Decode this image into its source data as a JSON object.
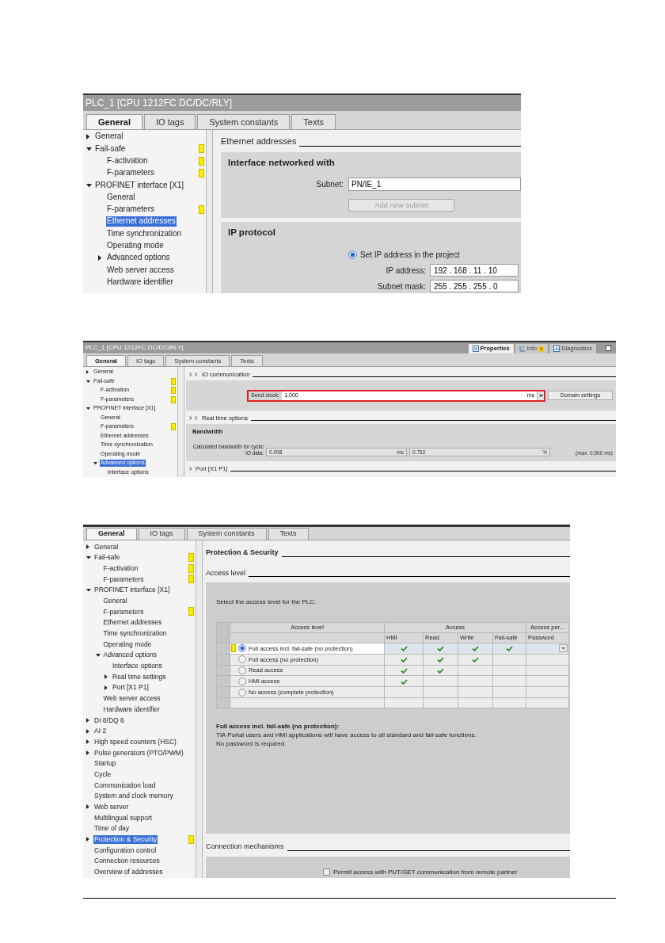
{
  "screenshots": [
    {
      "kind": "addresses",
      "title": "PLC_1 [CPU 1212FC DC/DC/RLY]",
      "tabs": [
        {
          "label": "General",
          "selected": true
        },
        {
          "label": "IO tags",
          "selected": false
        },
        {
          "label": "System constants",
          "selected": false
        },
        {
          "label": "Texts",
          "selected": false
        }
      ],
      "tree": [
        {
          "label": "General",
          "expanded": false,
          "selected": false,
          "flagged": false
        },
        {
          "label": "Fail-safe",
          "expanded": true,
          "selected": false,
          "flagged": true,
          "children": [
            {
              "label": "F-activation",
              "selected": false,
              "flagged": true
            },
            {
              "label": "F-parameters",
              "selected": false,
              "flagged": true
            }
          ]
        },
        {
          "label": "PROFINET interface [X1]",
          "expanded": true,
          "selected": false,
          "flagged": false,
          "children": [
            {
              "label": "General",
              "selected": false,
              "flagged": false
            },
            {
              "label": "F-parameters",
              "selected": false,
              "flagged": true
            },
            {
              "label": "Ethernet addresses",
              "selected": true,
              "flagged": false
            },
            {
              "label": "Time synchronization",
              "selected": false,
              "flagged": false
            },
            {
              "label": "Operating mode",
              "selected": false,
              "flagged": false
            },
            {
              "label": "Advanced options",
              "expanded": false,
              "selected": false,
              "flagged": false
            },
            {
              "label": "Web server access",
              "selected": false,
              "flagged": false
            },
            {
              "label": "Hardware identifier",
              "selected": false,
              "flagged": false
            }
          ]
        }
      ],
      "heading": "Ethernet addresses",
      "network_panel": {
        "title": "Interface networked with",
        "subnet_label": "Subnet:",
        "subnet_value": "PN/IE_1",
        "add_button": {
          "label": "Add new subnet",
          "disabled": true
        }
      },
      "ip_panel": {
        "title": "IP protocol",
        "option": {
          "label": "Set IP address in the project",
          "selected": true
        },
        "fields": [
          {
            "label": "IP address:",
            "value": "192 . 168 . 11 . 10"
          },
          {
            "label": "Subnet mask:",
            "value": "255 . 255 . 255 . 0"
          }
        ]
      }
    },
    {
      "kind": "communication",
      "title": "PLC_1 [CPU 1212FC DC/DC/RLY]",
      "panel_tabs": [
        {
          "label": "Properties",
          "selected": true
        },
        {
          "label": "Info",
          "selected": false
        },
        {
          "label": "Diagnostics",
          "selected": false
        }
      ],
      "tabs": [
        {
          "label": "General",
          "selected": true
        },
        {
          "label": "IO tags",
          "selected": false
        },
        {
          "label": "System constants",
          "selected": false
        },
        {
          "label": "Texts",
          "selected": false
        }
      ],
      "tree": [
        {
          "label": "General",
          "expanded": false,
          "selected": false,
          "flagged": false
        },
        {
          "label": "Fail-safe",
          "expanded": true,
          "selected": false,
          "flagged": true,
          "children": [
            {
              "label": "F-activation",
              "selected": false,
              "flagged": true
            },
            {
              "label": "F-parameters",
              "selected": false,
              "flagged": true
            }
          ]
        },
        {
          "label": "PROFINET interface [X1]",
          "expanded": true,
          "selected": false,
          "flagged": false,
          "children": [
            {
              "label": "General",
              "selected": false,
              "flagged": false
            },
            {
              "label": "F-parameters",
              "selected": false,
              "flagged": true
            },
            {
              "label": "Ethernet addresses",
              "selected": false,
              "flagged": false
            },
            {
              "label": "Time synchronization",
              "selected": false,
              "flagged": false
            },
            {
              "label": "Operating mode",
              "selected": false,
              "flagged": false
            },
            {
              "label": "Advanced options",
              "expanded": true,
              "selected": true,
              "flagged": false,
              "children": [
                {
                  "label": "Interface options",
                  "selected": false,
                  "flagged": false
                }
              ]
            }
          ]
        }
      ],
      "blocks": [
        {
          "kind": "heading",
          "label": "IO communication",
          "nested": true
        },
        {
          "kind": "send_clock",
          "label": "Send clock:",
          "value": "1.000",
          "unit": "ms",
          "highlighted": true,
          "button": "Domain settings"
        },
        {
          "kind": "heading",
          "label": "Real time options",
          "nested": true
        },
        {
          "kind": "bandwidth",
          "title": "Bandwidth",
          "label": "Calculated bandwidth for cyclic IO data:",
          "fields": [
            {
              "value": "0.008",
              "unit": "ms"
            },
            {
              "value": "0.752",
              "unit": "%"
            }
          ],
          "note": "(max. 0.500 ms)"
        },
        {
          "kind": "heading",
          "label": "Port [X1 P1]",
          "nested": false
        }
      ]
    },
    {
      "kind": "security",
      "tabs": [
        {
          "label": "General",
          "selected": true
        },
        {
          "label": "IO tags",
          "selected": false
        },
        {
          "label": "System constants",
          "selected": false
        },
        {
          "label": "Texts",
          "selected": false
        }
      ],
      "tree": [
        {
          "label": "General",
          "expanded": false,
          "selected": false,
          "flagged": false
        },
        {
          "label": "Fail-safe",
          "expanded": true,
          "selected": false,
          "flagged": true,
          "children": [
            {
              "label": "F-activation",
              "selected": false,
              "flagged": true
            },
            {
              "label": "F-parameters",
              "selected": false,
              "flagged": true
            }
          ]
        },
        {
          "label": "PROFINET interface [X1]",
          "expanded": true,
          "selected": false,
          "flagged": false,
          "children": [
            {
              "label": "General",
              "selected": false,
              "flagged": false
            },
            {
              "label": "F-parameters",
              "selected": false,
              "flagged": true
            },
            {
              "label": "Ethernet addresses",
              "selected": false,
              "flagged": false
            },
            {
              "label": "Time synchronization",
              "selected": false,
              "flagged": false
            },
            {
              "label": "Operating mode",
              "selected": false,
              "flagged": false
            },
            {
              "label": "Advanced options",
              "expanded": true,
              "selected": false,
              "flagged": false,
              "children": [
                {
                  "label": "Interface options",
                  "selected": false,
                  "flagged": false
                },
                {
                  "label": "Real time settings",
                  "expanded": false,
                  "selected": false,
                  "flagged": false
                },
                {
                  "label": "Port [X1 P1]",
                  "expanded": false,
                  "selected": false,
                  "flagged": false
                }
              ]
            },
            {
              "label": "Web server access",
              "selected": false,
              "flagged": false
            },
            {
              "label": "Hardware identifier",
              "selected": false,
              "flagged": false
            }
          ]
        },
        {
          "label": "DI 8/DQ 6",
          "expanded": false,
          "selected": false,
          "flagged": false
        },
        {
          "label": "AI 2",
          "expanded": false,
          "selected": false,
          "flagged": false
        },
        {
          "label": "High speed counters (HSC)",
          "expanded": false,
          "selected": false,
          "flagged": false
        },
        {
          "label": "Pulse generators (PTO/PWM)",
          "expanded": false,
          "selected": false,
          "flagged": false
        },
        {
          "label": "Startup",
          "selected": false,
          "flagged": false
        },
        {
          "label": "Cycle",
          "selected": false,
          "flagged": false
        },
        {
          "label": "Communication load",
          "selected": false,
          "flagged": false
        },
        {
          "label": "System and clock memory",
          "selected": false,
          "flagged": false
        },
        {
          "label": "Web server",
          "expanded": false,
          "selected": false,
          "flagged": false
        },
        {
          "label": "Multilingual support",
          "selected": false,
          "flagged": false
        },
        {
          "label": "Time of day",
          "selected": false,
          "flagged": false
        },
        {
          "label": "Protection & Security",
          "expanded": false,
          "selected": true,
          "flagged": true
        },
        {
          "label": "Configuration control",
          "selected": false,
          "flagged": false
        },
        {
          "label": "Connection resources",
          "selected": false,
          "flagged": false
        },
        {
          "label": "Overview of addresses",
          "selected": false,
          "flagged": false
        }
      ],
      "title": "Protection & Security",
      "access_heading": "Access level",
      "prompt": "Select the access level for the PLC.",
      "table": {
        "column_groups": [
          {
            "label": "Access level"
          },
          {
            "label": "Access",
            "columns": [
              "HMI",
              "Read",
              "Write",
              "Fail-safe"
            ]
          },
          {
            "label": "Access per...",
            "columns": [
              "Password"
            ]
          }
        ],
        "rows": [
          {
            "label": "Full access incl. fail-safe (no protection)",
            "selected": true,
            "flagged": true,
            "access": [
              true,
              true,
              true,
              true
            ]
          },
          {
            "label": "Full access (no protection)",
            "selected": false,
            "flagged": false,
            "access": [
              true,
              true,
              true,
              false
            ]
          },
          {
            "label": "Read access",
            "selected": false,
            "flagged": false,
            "access": [
              true,
              true,
              false,
              false
            ]
          },
          {
            "label": "HMI access",
            "selected": false,
            "flagged": false,
            "access": [
              true,
              false,
              false,
              false
            ]
          },
          {
            "label": "No access (complete protection)",
            "selected": false,
            "flagged": false,
            "access": [
              false,
              false,
              false,
              false
            ]
          }
        ]
      },
      "description": {
        "title": "Full access incl. fail-safe (no protection):",
        "lines": [
          "TIA Portal users and HMI applications will have access to all standard and fail-safe functions.",
          "No password is required."
        ]
      },
      "connection_heading": "Connection mechanisms",
      "put_get": {
        "label": "Permit access with PUT/GET communication from remote partner",
        "checked": false
      }
    }
  ]
}
